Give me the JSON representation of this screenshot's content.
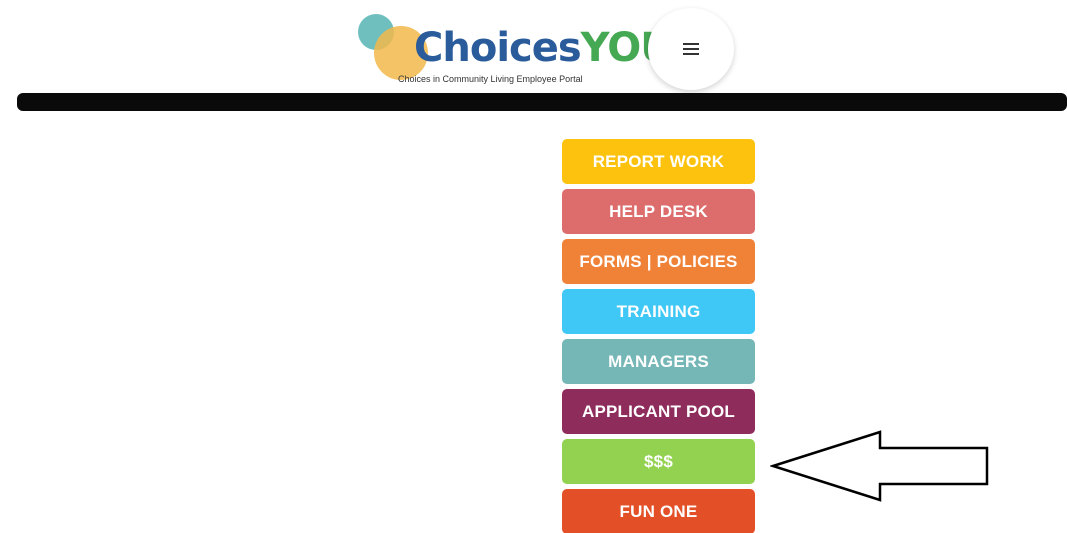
{
  "header": {
    "brand_part1": "Choices",
    "brand_part2": "YOU",
    "tagline": "Choices in Community Living Employee Portal"
  },
  "menu_buttons": [
    {
      "label": "REPORT WORK",
      "color": "#fcc20d"
    },
    {
      "label": "HELP DESK",
      "color": "#dd6d6d"
    },
    {
      "label": "FORMS | POLICIES",
      "color": "#f08238"
    },
    {
      "label": "TRAINING",
      "color": "#3fc7f6"
    },
    {
      "label": "MANAGERS",
      "color": "#75b6b6"
    },
    {
      "label": "APPLICANT POOL",
      "color": "#8e2c5c"
    },
    {
      "label": "$$$",
      "color": "#93d150"
    },
    {
      "label": "FUN ONE",
      "color": "#e34f27"
    }
  ],
  "colors": {
    "nav_bar": "#0a0a0a",
    "brand_blue": "#2a5b9b",
    "brand_green": "#45a853"
  },
  "annotation": {
    "icon": "left-arrow-outline-icon"
  }
}
